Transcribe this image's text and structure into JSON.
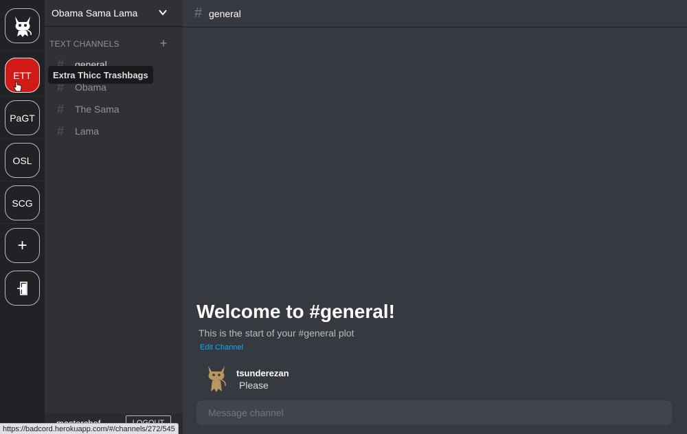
{
  "servers": [
    {
      "id": "home",
      "label": "",
      "icon": "devil-cat-icon"
    },
    {
      "id": "ett",
      "label": "ETT",
      "active": true
    },
    {
      "id": "pagt",
      "label": "PaGT"
    },
    {
      "id": "osl",
      "label": "OSL"
    },
    {
      "id": "scg",
      "label": "SCG"
    },
    {
      "id": "add",
      "label": "+",
      "icon": "plus-icon"
    },
    {
      "id": "exit",
      "label": "",
      "icon": "door-exit-icon"
    }
  ],
  "tooltip": "Extra Thicc Trashbags",
  "sidebar": {
    "server_name": "Obama Sama Lama",
    "category": "TEXT CHANNELS",
    "add_symbol": "+",
    "channels": [
      "general",
      "Obama",
      "The Sama",
      "Lama"
    ],
    "username": "masterchef",
    "logout_label": "LOGOUT"
  },
  "main": {
    "channel_hash": "#",
    "channel_title": "general",
    "welcome": "Welcome to #general!",
    "start_text": "This is the start of your #general plot",
    "edit_label": "Edit Channel",
    "message": {
      "author": "tsunderezan",
      "body": "Please"
    },
    "composer_placeholder": "Message channel"
  },
  "status_url": "https://badcord.herokuapp.com/#/channels/272/545",
  "colors": {
    "active_server": "#d11a15",
    "link": "#00b0f4",
    "background": "#36393f",
    "sidebar": "#2f3136",
    "rail": "#202225"
  }
}
